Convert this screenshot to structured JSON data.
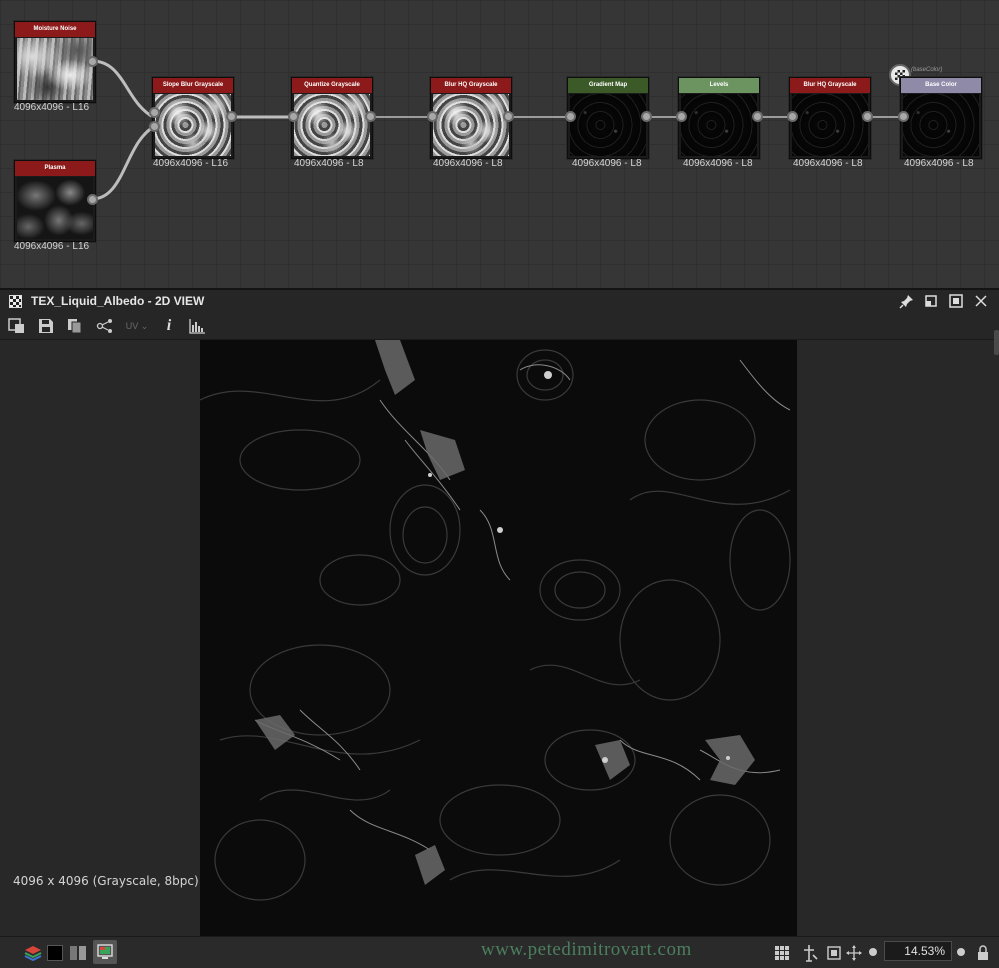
{
  "graph": {
    "nodes": [
      {
        "id": "moisture",
        "title": "Moisture Noise",
        "resolution": "4096x4096 - L16",
        "header_color": "#8c1a1a"
      },
      {
        "id": "plasma",
        "title": "Plasma",
        "resolution": "4096x4096 - L16",
        "header_color": "#8c1a1a"
      },
      {
        "id": "slope",
        "title": "Slope Blur Grayscale",
        "resolution": "4096x4096 - L16",
        "header_color": "#8c1a1a"
      },
      {
        "id": "quantize",
        "title": "Quantize Grayscale",
        "resolution": "4096x4096 - L8",
        "header_color": "#8c1a1a"
      },
      {
        "id": "blur1",
        "title": "Blur HQ Grayscale",
        "resolution": "4096x4096 - L8",
        "header_color": "#8c1a1a"
      },
      {
        "id": "gradient",
        "title": "Gradient Map",
        "resolution": "4096x4096 - L8",
        "header_color": "#3b5a28"
      },
      {
        "id": "levels",
        "title": "Levels",
        "resolution": "4096x4096 - L8",
        "header_color": "#6c9460"
      },
      {
        "id": "blur2",
        "title": "Blur HQ Grayscale",
        "resolution": "4096x4096 - L8",
        "header_color": "#8c1a1a"
      },
      {
        "id": "basecolor",
        "title": "Base Color",
        "resolution": "4096x4096 - L8",
        "header_color": "#8e8aa8"
      }
    ],
    "output_label": "(baseColor)",
    "output_icon": "output-node-icon"
  },
  "view": {
    "title": "TEX_Liquid_Albedo - 2D VIEW",
    "title_icon": "checker-icon",
    "title_buttons": [
      "pin-icon",
      "float-icon",
      "maximize-icon",
      "close-icon"
    ],
    "toolbar": {
      "icons": [
        "export-icon",
        "save-icon",
        "copy-icon",
        "share-icon",
        "info-icon",
        "histogram-icon"
      ],
      "uv_label": "UV",
      "info_glyph": "i"
    },
    "image_info": "4096 x 4096 (Grayscale, 8bpc)"
  },
  "status": {
    "left_icons": [
      "layers-icon",
      "black-swatch-icon",
      "grid-channels-icon",
      "color-display-icon"
    ],
    "watermark": "www.petedimitrovart.com",
    "right_icons": [
      "tiling-icon",
      "tool-icon",
      "fit-icon",
      "pan-icon"
    ],
    "zoom_value": "14.53%"
  },
  "colors": {
    "panel_bg": "#262626",
    "graph_bg": "#363636",
    "node_red": "#8c1a1a",
    "watermark": "#4c7f5e"
  }
}
